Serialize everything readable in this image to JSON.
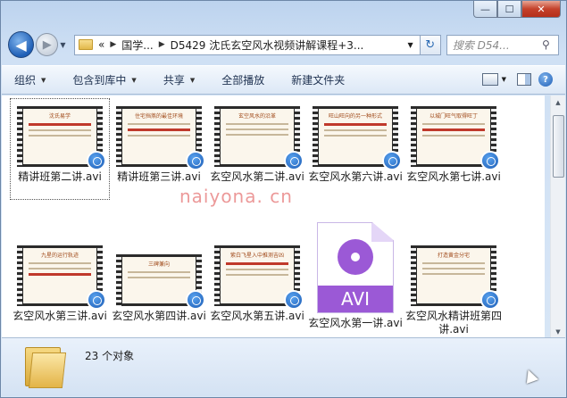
{
  "window": {
    "caption": {
      "minimize": "—",
      "maximize": "☐",
      "close": "✕"
    }
  },
  "nav": {
    "back_icon": "◀",
    "forward_icon": "▶",
    "breadcrumb": [
      "«",
      "国学...",
      "D5429 沈氏玄空风水视频讲解课程+3..."
    ],
    "refresh_icon": "↻",
    "search_placeholder": "搜索 D54...",
    "search_icon": "⚲"
  },
  "toolbar": {
    "organize": "组织",
    "include_library": "包含到库中",
    "share": "共享",
    "play_all": "全部播放",
    "new_folder": "新建文件夹"
  },
  "files": [
    {
      "name": "精讲班第二讲.avi",
      "frame_title": "沈氏易学"
    },
    {
      "name": "精讲班第三讲.avi",
      "frame_title": "住宅挡煞的最佳环境"
    },
    {
      "name": "玄空风水第二讲.avi",
      "frame_title": "玄空风水的沿革"
    },
    {
      "name": "玄空风水第六讲.avi",
      "frame_title": "旺山旺向的另一种形式"
    },
    {
      "name": "玄空风水第七讲.avi",
      "frame_title": "以城门旺气取得旺丁"
    },
    {
      "name": "玄空风水第三讲.avi",
      "frame_title": "九星的运行轨迹"
    },
    {
      "name": "玄空风水第四讲.avi",
      "frame_title": "三碑兼向"
    },
    {
      "name": "玄空风水第五讲.avi",
      "frame_title": "紫白飞星入中推测吉凶"
    },
    {
      "name": "玄空风水第一讲.avi",
      "frame_title": "AVI"
    },
    {
      "name": "玄空风水精讲班第四讲.avi",
      "frame_title": "打造黄金分宅"
    }
  ],
  "avi_icon_label": "AVI",
  "watermark": "naiyona. cn",
  "status": {
    "count_text": "23 个对象"
  }
}
